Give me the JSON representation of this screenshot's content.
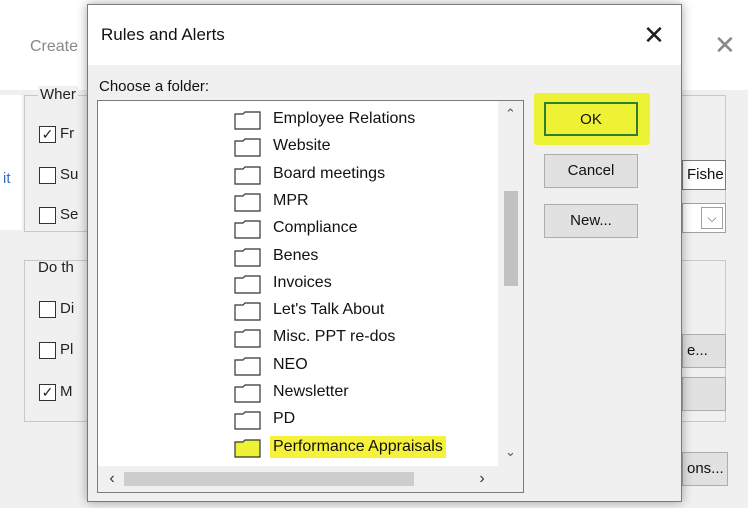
{
  "background_dialog": {
    "title": "Create",
    "when_group_label": "Wher",
    "when_options": [
      {
        "label": "Fr",
        "checked": true
      },
      {
        "label": "Su",
        "checked": false
      },
      {
        "label": "Se",
        "checked": false
      }
    ],
    "left_fragment": "it",
    "from_input_value": "Fishe",
    "do_group_label": "Do th",
    "do_options": [
      {
        "label": "Di",
        "checked": false
      },
      {
        "label": "Pl",
        "checked": false
      },
      {
        "label": "M",
        "checked": true
      }
    ],
    "browse_button_label": "e...",
    "options_button_label": "ons..."
  },
  "dialog": {
    "title": "Rules and Alerts",
    "choose_label": "Choose a folder:",
    "folders": [
      "Employee Relations",
      "Website",
      "Board meetings",
      "MPR",
      "Compliance",
      "Benes",
      "Invoices",
      "Let's Talk About",
      "Misc. PPT re-dos",
      "NEO",
      "Newsletter",
      "PD",
      "Performance Appraisals"
    ],
    "selected_folder": "Performance Appraisals",
    "buttons": {
      "ok": "OK",
      "cancel": "Cancel",
      "new": "New..."
    },
    "highlight_color": "#eef235"
  },
  "icons": {
    "close": "close-icon",
    "folder": "folder-icon",
    "scroll_up": "chevron-up-icon",
    "scroll_down": "chevron-down-icon",
    "scroll_left": "chevron-left-icon",
    "scroll_right": "chevron-right-icon"
  }
}
